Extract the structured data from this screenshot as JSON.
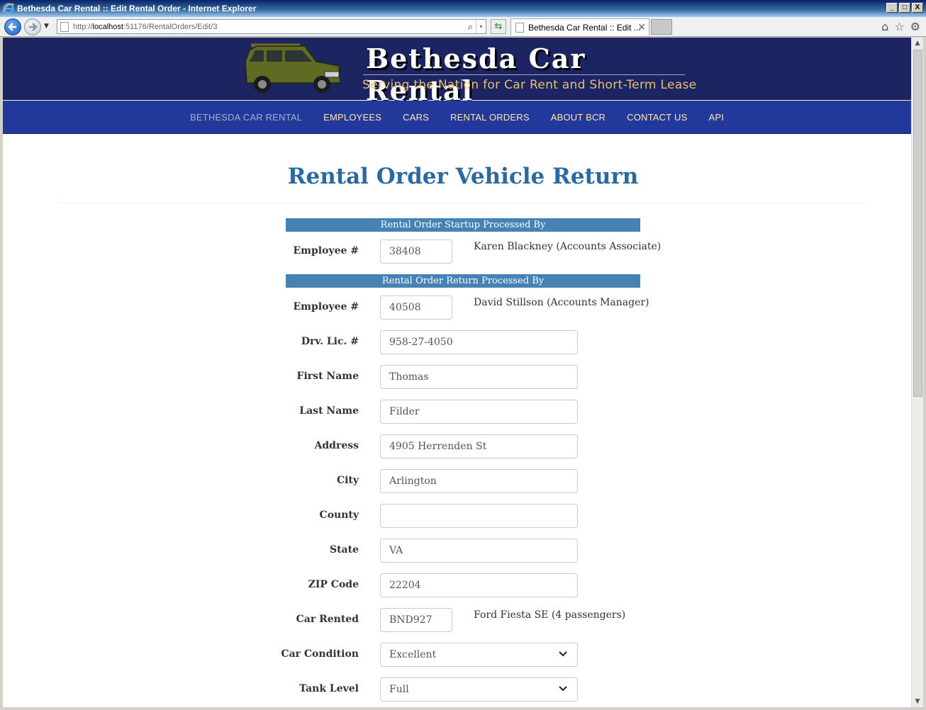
{
  "window": {
    "title": "Bethesda Car Rental :: Edit Rental Order - Internet Explorer",
    "address_url_prefix": "http://",
    "address_url_host": "localhost",
    "address_url_path": ":51176/RentalOrders/Edit/3",
    "tab_title": "Bethesda Car Rental :: Edit ...",
    "tab_close": "✕",
    "controls": {
      "minimize": "_",
      "maximize": "□",
      "close": "X"
    },
    "nav_drop": "▼",
    "address_drop": "▾",
    "refresh_glyph": "⇆",
    "search_glyph": "⌕",
    "home_glyph": "⌂",
    "favorites_glyph": "☆",
    "tools_glyph": "⚙"
  },
  "site": {
    "brand_title": "Bethesda Car Rental",
    "tagline": "Serving the Nation for Car Rent and Short-Term Lease",
    "nav": [
      {
        "label": "BETHESDA CAR RENTAL"
      },
      {
        "label": "EMPLOYEES"
      },
      {
        "label": "CARS"
      },
      {
        "label": "RENTAL ORDERS"
      },
      {
        "label": "ABOUT BCR"
      },
      {
        "label": "CONTACT US"
      },
      {
        "label": "API"
      }
    ]
  },
  "page": {
    "title": "Rental Order Vehicle Return",
    "startup_section": "Rental Order Startup Processed By",
    "return_section": "Rental Order Return Processed By",
    "startup_employee": {
      "label": "Employee #",
      "value": "38408",
      "name": "Karen Blackney (Accounts Associate)"
    },
    "return_employee": {
      "label": "Employee #",
      "value": "40508",
      "name": "David Stillson (Accounts Manager)"
    },
    "fields": {
      "drv_lic": {
        "label": "Drv. Lic. #",
        "value": "958-27-4050"
      },
      "first_name": {
        "label": "First Name",
        "value": "Thomas"
      },
      "last_name": {
        "label": "Last Name",
        "value": "Filder"
      },
      "address": {
        "label": "Address",
        "value": "4905 Herrenden St"
      },
      "city": {
        "label": "City",
        "value": "Arlington"
      },
      "county": {
        "label": "County",
        "value": ""
      },
      "state": {
        "label": "State",
        "value": "VA"
      },
      "zip": {
        "label": "ZIP Code",
        "value": "22204"
      },
      "car_rented": {
        "label": "Car Rented",
        "value": "BND927",
        "description": "Ford Fiesta SE (4 passengers)"
      },
      "car_condition": {
        "label": "Car Condition",
        "value": "Excellent"
      },
      "tank_level": {
        "label": "Tank Level",
        "value": "Full"
      }
    }
  },
  "colors": {
    "header_bg": "#1c2461",
    "nav_bg": "#22389a",
    "nav_link": "#ffe9a8",
    "section_bar": "#4682b4",
    "page_title": "#2a6aa0",
    "tagline": "#e8c070"
  }
}
